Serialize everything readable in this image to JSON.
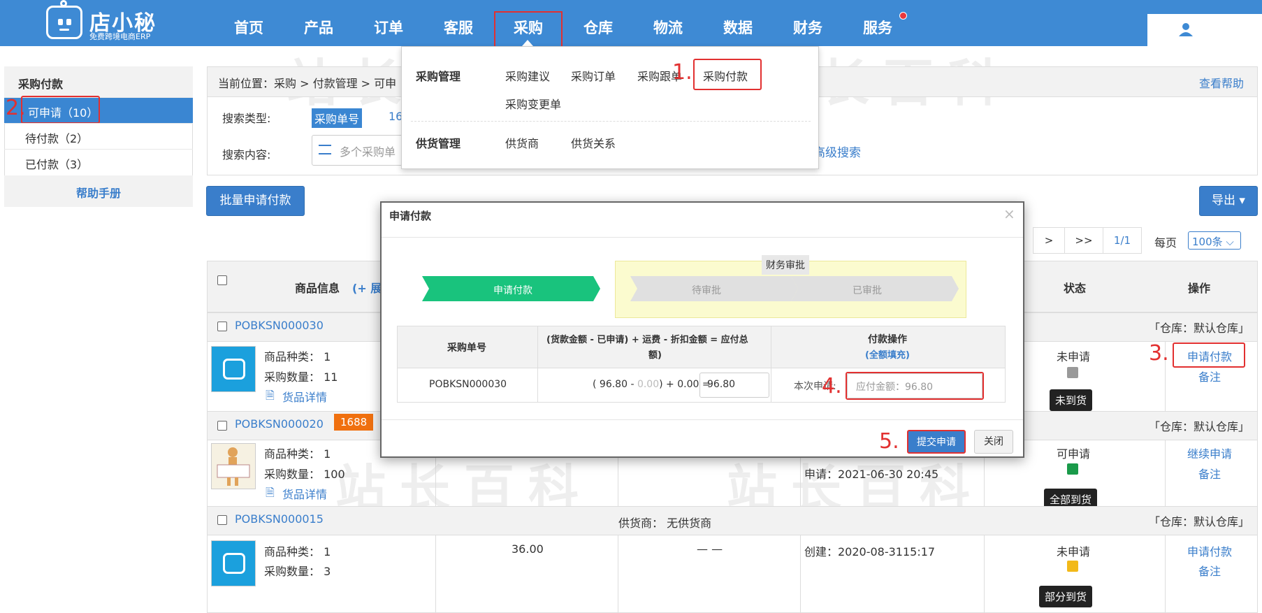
{
  "colors": {
    "accent": "#3e8ad4",
    "link": "#3a7ecb",
    "annotation": "#e23030",
    "badge_orange": "#f0700f",
    "flow_green": "#19c37d"
  },
  "brand": {
    "name": "店小秘",
    "tagline": "免费跨境电商ERP"
  },
  "nav": {
    "items": [
      "首页",
      "产品",
      "订单",
      "客服",
      "采购",
      "仓库",
      "物流",
      "数据",
      "财务",
      "服务"
    ],
    "active": "采购"
  },
  "dropdown": {
    "group1_title": "采购管理",
    "group1_items": [
      "采购建议",
      "采购订单",
      "采购跟单",
      "采购付款",
      "采购变更单"
    ],
    "group2_title": "供货管理",
    "group2_items": [
      "供货商",
      "供货关系"
    ]
  },
  "sidebar": {
    "title": "采购付款",
    "items": [
      "可申请（10）",
      "待付款（2）",
      "已付款（3）"
    ],
    "help": "帮助手册"
  },
  "annotations": {
    "a1": "1.",
    "a2": "2.",
    "a3": "3.",
    "a4": "4.",
    "a5": "5."
  },
  "breadcrumb": {
    "text": "当前位置：采购 > 付款管理 > 可申",
    "help": "查看帮助"
  },
  "search": {
    "type_label": "搜索类型:",
    "type_selected": "采购单号",
    "type_next": "16",
    "content_label": "搜索内容:",
    "content_placeholder": "多个采购单",
    "advanced": "高级搜索"
  },
  "toolbar": {
    "batch_button": "批量申请付款",
    "export_button": "导出 ▾"
  },
  "pager": {
    "next": ">",
    "last": ">>",
    "page": "1/1",
    "per_page_label": "每页",
    "per_page_value": "100条"
  },
  "table": {
    "headers": {
      "goods": "商品信息",
      "expand": "(+ 展",
      "status": "状态",
      "actions": "操作"
    },
    "rows": [
      {
        "id": "POBKSN000030",
        "badge": "",
        "warehouse": "「仓库：默认仓库」",
        "kinds": "商品种类：  1",
        "qty": "采购数量：  11",
        "detail": "货品详情",
        "status": "未申请",
        "arrival": "未到货",
        "action1": "申请付款",
        "action2": "备注"
      },
      {
        "id": "POBKSN000020",
        "badge": "1688",
        "warehouse": "「仓库：默认仓库」",
        "kinds": "商品种类：  1",
        "qty": "采购数量：  100",
        "detail": "货品详情",
        "apply_time": "申请：2021-06-30 20:45",
        "status": "可申请",
        "arrival": "全部到货",
        "action1": "继续申请",
        "action2": "备注"
      },
      {
        "id": "POBKSN000015",
        "badge": "",
        "supplier": "供货商：  无供货商",
        "warehouse": "「仓库：默认仓库」",
        "kinds": "商品种类：  1",
        "qty": "采购数量：  3",
        "amount": "36.00",
        "dash": "— —",
        "create_time": "创建：2020-08-3115:17",
        "status": "未申请",
        "arrival": "部分到货",
        "action1": "申请付款",
        "action2": "备注"
      }
    ]
  },
  "modal": {
    "title": "申请付款",
    "close_x": "×",
    "flow": {
      "step1": "申请付款",
      "group": "财务审批",
      "step2": "待审批",
      "step3": "已审批"
    },
    "table": {
      "h1": "采购单号",
      "h2_line1": "(货款金额 - 已申请) + 运费 - 折扣金额 = 应付总",
      "h2_line2": "额)",
      "h3": "付款操作",
      "h3_link": "(全额填充)",
      "order_no": "POBKSN000030",
      "formula_pre": "( 96.80 - ",
      "formula_applied": "0.00",
      "formula_post": ") + 0.00 =",
      "total": "96.80",
      "this_apply": "本次申请:",
      "pay_placeholder": "应付金额：96.80"
    },
    "submit": "提交申请",
    "close": "关闭"
  },
  "watermark": "站长百科"
}
